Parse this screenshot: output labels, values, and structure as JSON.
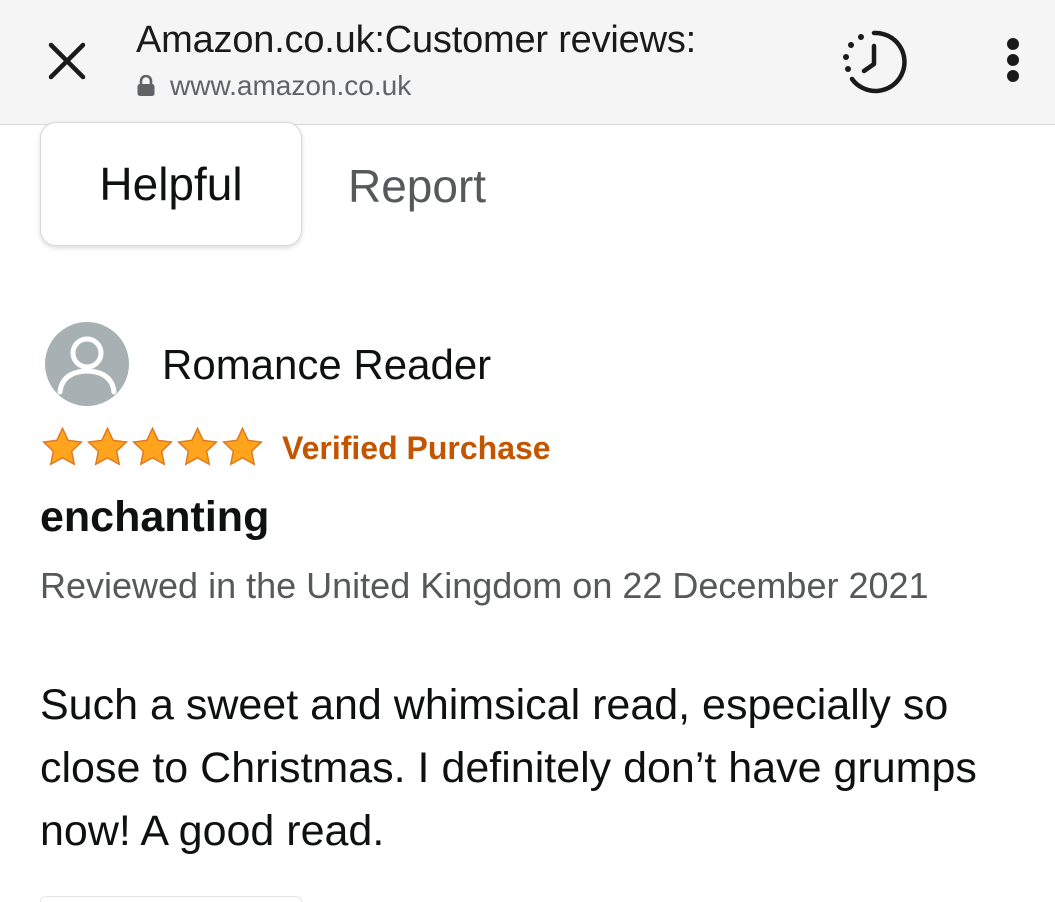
{
  "browser": {
    "title": "Amazon.co.uk:Customer reviews:",
    "url": "www.amazon.co.uk",
    "icons": {
      "close": "close-icon",
      "lock": "lock-icon",
      "history": "history-clock-icon",
      "menu": "more-vert-icon"
    }
  },
  "previous_review_actions": {
    "helpful_label": "Helpful",
    "report_label": "Report"
  },
  "review": {
    "reviewer_name": "Romance Reader",
    "rating": 5,
    "rating_max": 5,
    "badge": "Verified Purchase",
    "title": "enchanting",
    "date_line": "Reviewed in the United Kingdom on 22 December 2021",
    "body": "Such a sweet and whimsical read, especially so close to Christmas. I definitely don’t have grumps now! A good read."
  },
  "colors": {
    "star_fill": "#ffa41c",
    "star_stroke": "#de7921",
    "verified": "#c45500",
    "secondary_text": "#565959",
    "avatar_bg": "#a7b1b3"
  }
}
